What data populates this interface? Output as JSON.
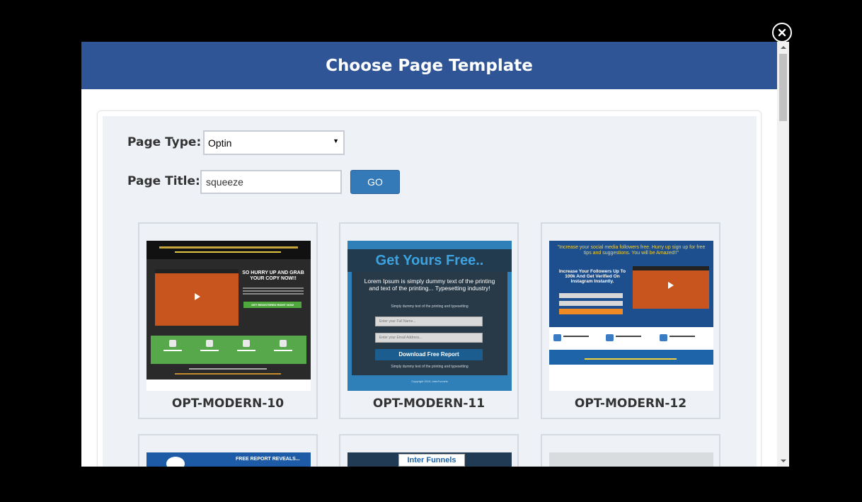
{
  "modal": {
    "title": "Choose Page Template"
  },
  "form": {
    "page_type_label": "Page Type:",
    "page_type_value": "Optin",
    "page_title_label": "Page Title:",
    "page_title_value": "squeeze",
    "go_label": "GO"
  },
  "templates": [
    {
      "name": "OPT-MODERN-10",
      "hurry_text": "SO HURRY UP AND GRAB YOUR COPY NOW!!",
      "cta_text": "GET REGISTERED RIGHT NOW"
    },
    {
      "name": "OPT-MODERN-11",
      "headline": "Get Yours Free..",
      "body": "Lorem Ipsum is simply dummy text of the printing and text of the printing... Typesetting industry!",
      "small": "Simply dummy text of the printing and typesetting",
      "name_placeholder": "Enter your Full Name...",
      "email_placeholder": "Enter your Email Address...",
      "button": "Download Free Report",
      "footer": "Simply dummy text of the printing and typesetting",
      "copyright": "Copyright 2019, InterFunnels"
    },
    {
      "name": "OPT-MODERN-12",
      "top_text": "\"Increase your social media followers free. Hurry up sign up for free tips and suggestions. You will be Amazed!!\"",
      "bold_text": "Increase Your Followers Up To 100k And Get Verified On Instagram Instantly."
    }
  ],
  "row2": {
    "t13_text": "FREE REPORT REVEALS...",
    "t14_logo": "Inter Funnels"
  },
  "icons": {
    "close": "close-icon",
    "dropdown": "chevron-down-icon",
    "play": "play-icon"
  },
  "colors": {
    "header": "#2f5596",
    "go_button": "#3479b8",
    "panel": "#eef1f6"
  }
}
